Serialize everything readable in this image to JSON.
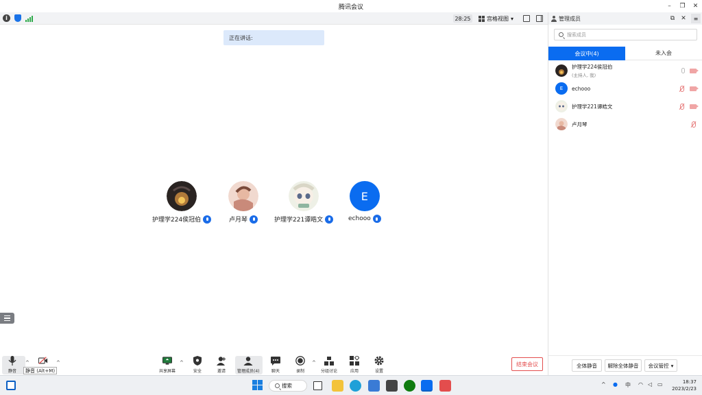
{
  "window": {
    "title": "腾讯会议"
  },
  "topbar": {
    "timer": "28:25",
    "view_label": "宫格视图",
    "view_caret": "▾"
  },
  "main": {
    "speaking_label": "正在讲话:",
    "participants": [
      {
        "name": "护理学224侯冠伯"
      },
      {
        "name": "卢月琴"
      },
      {
        "name": "护理学221谭皓文"
      },
      {
        "name": "echooo",
        "initial": "E"
      }
    ]
  },
  "toolbar": {
    "mute_label": "静音",
    "mute_tooltip": "静音 (Alt+M)",
    "share_label": "共享屏幕",
    "security_label": "安全",
    "invite_label": "邀请",
    "members_label": "管理成员(4)",
    "chat_label": "聊天",
    "record_label": "录制",
    "breakout_label": "分组讨论",
    "apps_label": "应用",
    "settings_label": "设置",
    "end_label": "结束会议"
  },
  "panel": {
    "title": "管理成员",
    "search_placeholder": "搜索成员",
    "tab_in_meeting": "会议中(4)",
    "tab_not_joined": "未入会",
    "members": [
      {
        "name": "护理学224侯冠伯",
        "sub": "(主持人, 我)"
      },
      {
        "name": "echooo",
        "initial": "E"
      },
      {
        "name": "护理学221谭皓文"
      },
      {
        "name": "卢月琴"
      }
    ],
    "mute_all": "全体静音",
    "unmute_all": "解除全体静音",
    "controls": "会议管控",
    "controls_caret": "▾"
  },
  "taskbar": {
    "search_label": "搜索",
    "ime": "中",
    "time": "18:37",
    "date": "2023/2/23"
  }
}
